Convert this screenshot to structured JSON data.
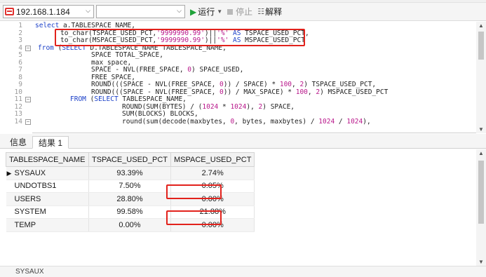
{
  "toolbar": {
    "connection": "192.168.1.184",
    "database": "",
    "run_label": "运行",
    "stop_label": "停止",
    "explain_label": "解释"
  },
  "editor": {
    "line_numbers": [
      "1",
      "2",
      "3",
      "4",
      "5",
      "6",
      "7",
      "8",
      "9",
      "10",
      "11",
      "12",
      "13",
      "14"
    ],
    "lines": [
      [
        {
          "t": "select ",
          "c": "kw"
        },
        {
          "t": "a.TABLESPACE_NAME,",
          "c": ""
        }
      ],
      [
        {
          "t": "to_char(TSPACE_USED_PCT,",
          "c": ""
        },
        {
          "t": "'9999990.99'",
          "c": "str"
        },
        {
          "t": ")||",
          "c": ""
        },
        {
          "t": "'%'",
          "c": "str"
        },
        {
          "t": " AS ",
          "c": "kw"
        },
        {
          "t": "TSPACE_USED_PCT,",
          "c": ""
        }
      ],
      [
        {
          "t": "to_char(MSPACE_USED_PCT,",
          "c": ""
        },
        {
          "t": "'9999990.99'",
          "c": "str"
        },
        {
          "t": ")||",
          "c": ""
        },
        {
          "t": "'%'",
          "c": "str"
        },
        {
          "t": " AS ",
          "c": "kw"
        },
        {
          "t": "MSPACE_USED_PCT",
          "c": ""
        }
      ],
      [
        {
          "t": "from ",
          "c": "kw"
        },
        {
          "t": "(",
          "c": ""
        },
        {
          "t": "SELECT ",
          "c": "kw"
        },
        {
          "t": "D.TABLESPACE_NAME TABLESPACE_NAME,",
          "c": ""
        }
      ],
      [
        {
          "t": "SPACE TOTAL_SPACE,",
          "c": ""
        }
      ],
      [
        {
          "t": "max_space,",
          "c": ""
        }
      ],
      [
        {
          "t": "SPACE - NVL(FREE_SPACE, ",
          "c": ""
        },
        {
          "t": "0",
          "c": "num"
        },
        {
          "t": ") SPACE_USED,",
          "c": ""
        }
      ],
      [
        {
          "t": "FREE_SPACE,",
          "c": ""
        }
      ],
      [
        {
          "t": "ROUND(((SPACE - NVL(FREE_SPACE, ",
          "c": ""
        },
        {
          "t": "0",
          "c": "num"
        },
        {
          "t": ")) / SPACE) * ",
          "c": ""
        },
        {
          "t": "100",
          "c": "num"
        },
        {
          "t": ", ",
          "c": ""
        },
        {
          "t": "2",
          "c": "num"
        },
        {
          "t": ") TSPACE_USED_PCT,",
          "c": ""
        }
      ],
      [
        {
          "t": "ROUND(((SPACE - NVL(FREE_SPACE, ",
          "c": ""
        },
        {
          "t": "0",
          "c": "num"
        },
        {
          "t": ")) / MAX_SPACE) * ",
          "c": ""
        },
        {
          "t": "100",
          "c": "num"
        },
        {
          "t": ", ",
          "c": ""
        },
        {
          "t": "2",
          "c": "num"
        },
        {
          "t": ") MSPACE_USED_PCT",
          "c": ""
        }
      ],
      [
        {
          "t": "FROM ",
          "c": "kw"
        },
        {
          "t": "(",
          "c": ""
        },
        {
          "t": "SELECT ",
          "c": "kw"
        },
        {
          "t": "TABLESPACE_NAME,",
          "c": ""
        }
      ],
      [
        {
          "t": "ROUND(SUM(BYTES) / (",
          "c": ""
        },
        {
          "t": "1024",
          "c": "num"
        },
        {
          "t": " * ",
          "c": ""
        },
        {
          "t": "1024",
          "c": "num"
        },
        {
          "t": "), ",
          "c": ""
        },
        {
          "t": "2",
          "c": "num"
        },
        {
          "t": ") SPACE,",
          "c": ""
        }
      ],
      [
        {
          "t": "SUM(BLOCKS) BLOCKS,",
          "c": ""
        }
      ],
      [
        {
          "t": "round(sum(decode(maxbytes, ",
          "c": ""
        },
        {
          "t": "0",
          "c": "num"
        },
        {
          "t": ", bytes, maxbytes) / ",
          "c": ""
        },
        {
          "t": "1024",
          "c": "num"
        },
        {
          "t": " / ",
          "c": ""
        },
        {
          "t": "1024",
          "c": "num"
        },
        {
          "t": "),",
          "c": ""
        }
      ]
    ]
  },
  "result_tabs": [
    "信息",
    "结果 1"
  ],
  "result_grid": {
    "columns": [
      "TABLESPACE_NAME",
      "TSPACE_USED_PCT",
      "MSPACE_USED_PCT"
    ],
    "rows": [
      [
        "SYSAUX",
        "93.39%",
        "2.74%"
      ],
      [
        "UNDOTBS1",
        "7.50%",
        "0.05%"
      ],
      [
        "USERS",
        "28.80%",
        "0.00%"
      ],
      [
        "SYSTEM",
        "99.58%",
        "21.88%"
      ],
      [
        "TEMP",
        "0.00%",
        "0.00%"
      ]
    ]
  },
  "status_bar": {
    "text": "SYSAUX"
  },
  "colors": {
    "highlight": "#e2221c",
    "keyword": "#1a3fc8",
    "string": "#b8168a",
    "run_icon": "#1fa23a"
  }
}
